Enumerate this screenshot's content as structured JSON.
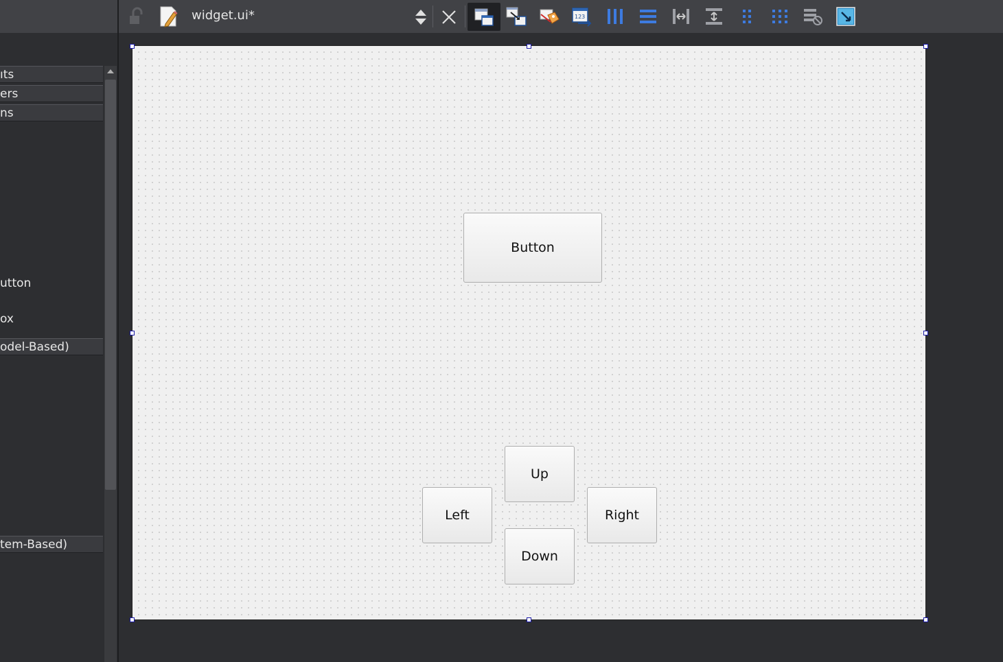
{
  "widget_box": {
    "categories": [
      {
        "label": "ıts"
      },
      {
        "label": "ers"
      },
      {
        "label": "ns"
      },
      {
        "label": "odel-Based)"
      },
      {
        "label": "tem-Based)"
      }
    ],
    "items": [
      {
        "label": "utton"
      },
      {
        "label": "ox"
      }
    ]
  },
  "toolbar": {
    "document_title": "widget.ui*",
    "icons": [
      "lock-icon",
      "file-edit-icon",
      "sort-updown-icon",
      "close-icon",
      "edit-widgets-icon",
      "edit-signals-slots-icon",
      "edit-buddies-icon",
      "edit-tab-order-icon",
      "layout-horizontal-icon",
      "layout-vertical-icon",
      "layout-h-splitter-icon",
      "layout-v-splitter-icon",
      "layout-form-icon",
      "layout-grid-icon",
      "break-layout-icon",
      "adjust-size-icon"
    ]
  },
  "form": {
    "buttons": {
      "main": "Button",
      "up": "Up",
      "left": "Left",
      "right": "Right",
      "down": "Down"
    }
  },
  "colors": {
    "panel_bg": "#2d2e31",
    "toolbar_bg": "#414246",
    "form_bg": "#f0f0f0",
    "selection_handle": "#1a1aa8"
  }
}
